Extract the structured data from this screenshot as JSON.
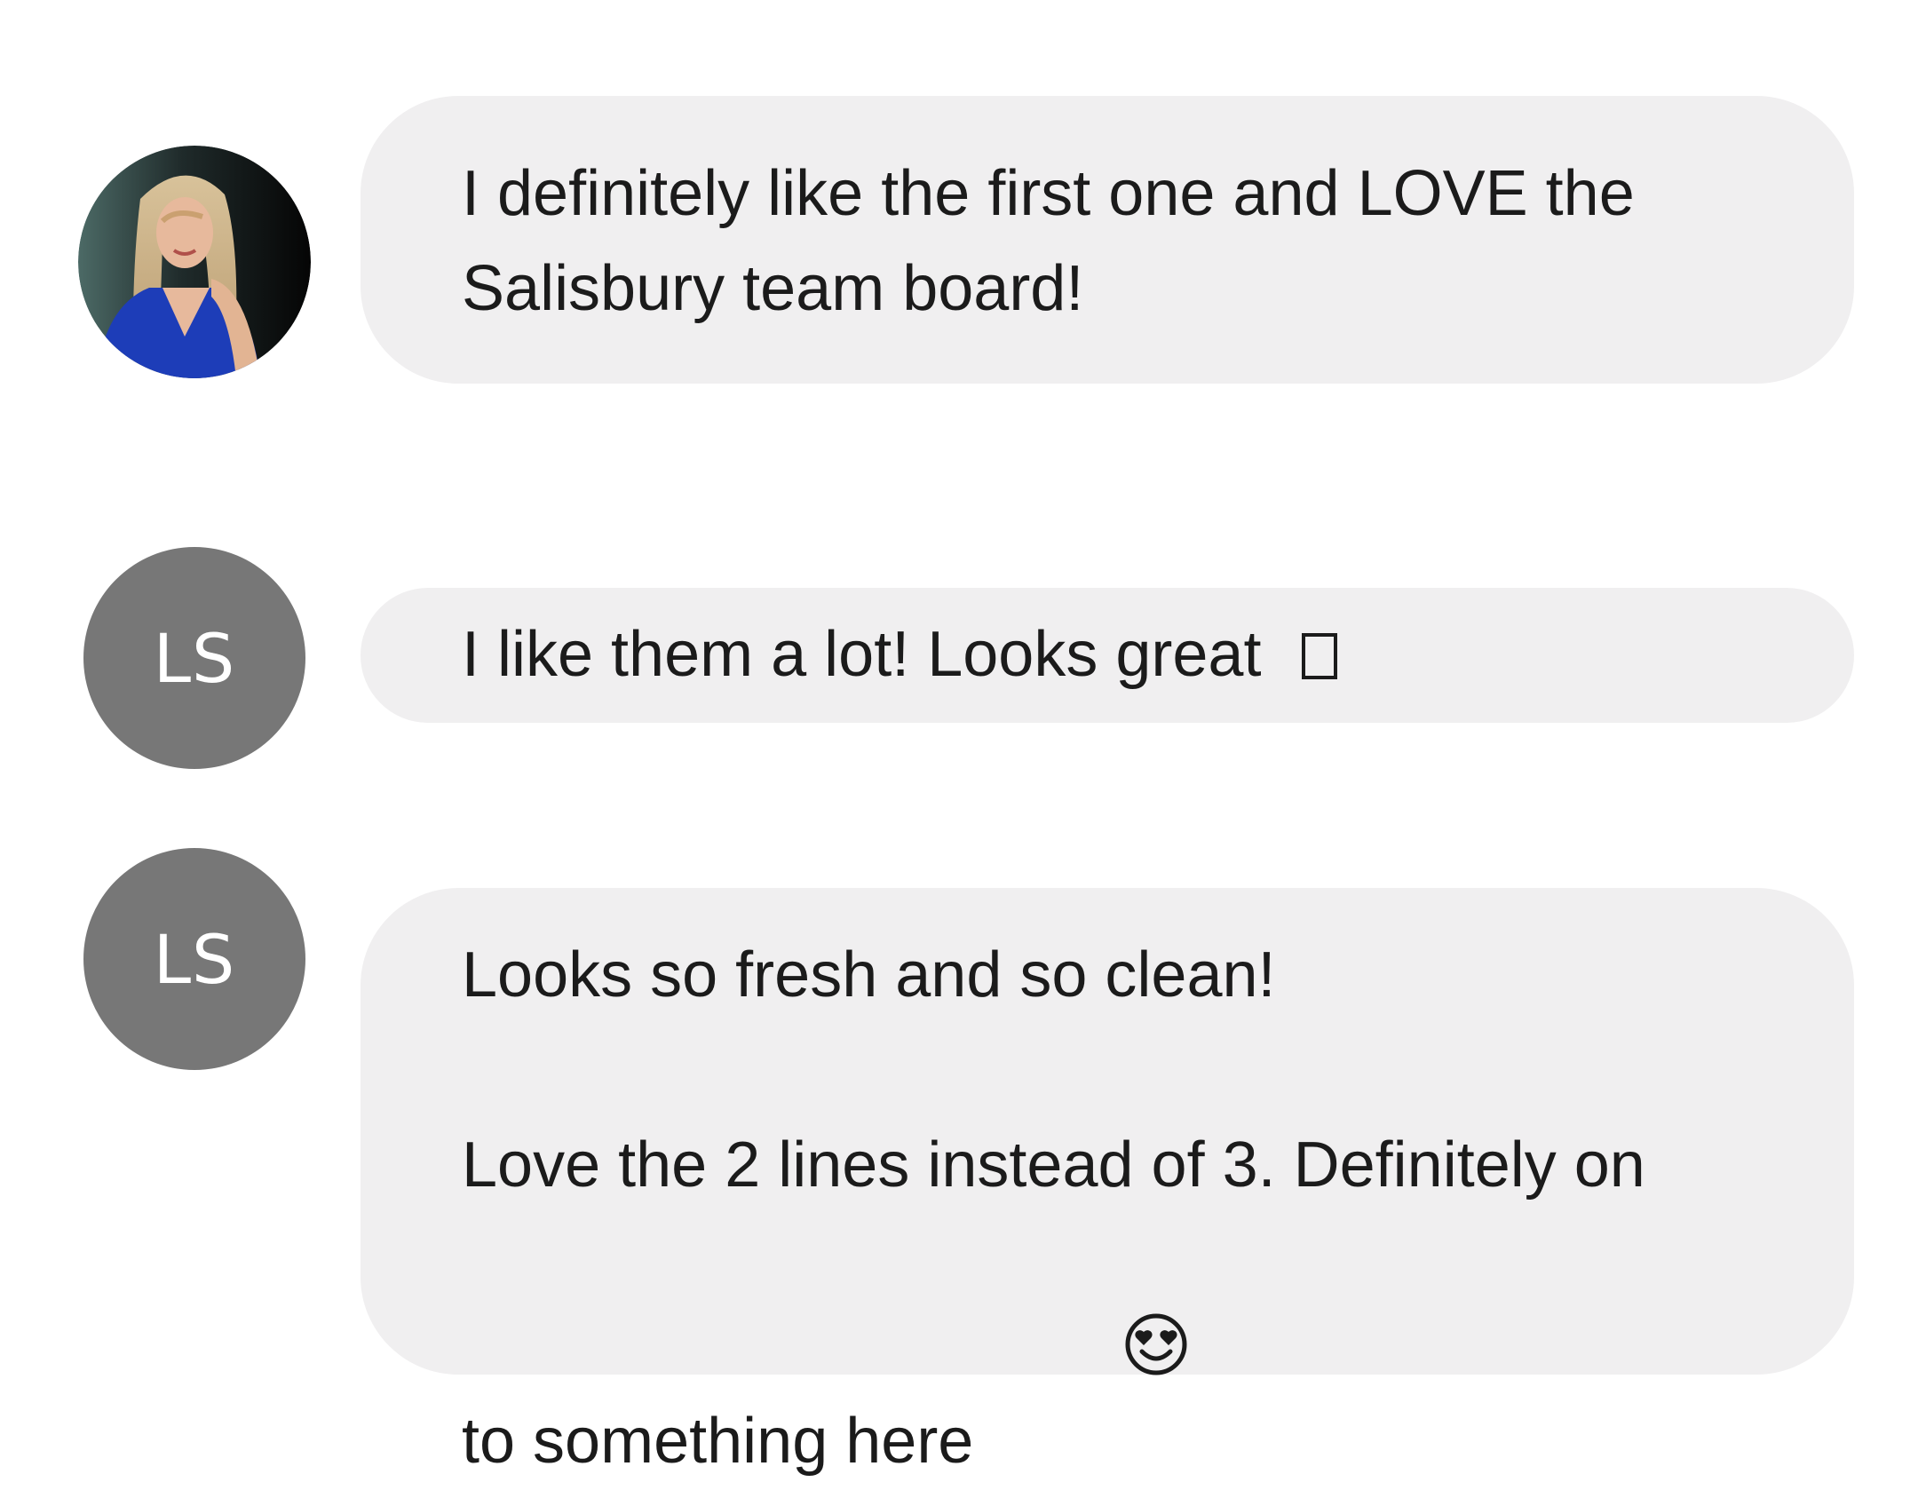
{
  "messages": [
    {
      "avatar": {
        "type": "photo",
        "icon": "user-photo"
      },
      "lines": [
        "I definitely like the first one and LOVE the",
        "Salisbury team board!"
      ]
    },
    {
      "avatar": {
        "type": "initials",
        "initials": "LS",
        "color": "#777777"
      },
      "text": "I like them a lot! Looks great",
      "trailing_icon": "unrendered-emoji-box"
    },
    {
      "avatar": {
        "type": "initials",
        "initials": "LS",
        "color": "#777777"
      },
      "paragraph1": "Looks so fresh and so clean!",
      "paragraph2_line1": "Love the 2 lines instead of 3. Definitely on",
      "paragraph2_line2": "to something here",
      "trailing_icon": "heart-eyes-emoji"
    }
  ],
  "colors": {
    "bubble_background": "#f0eff0",
    "avatar_background": "#777777",
    "text": "#1b1b1b"
  }
}
